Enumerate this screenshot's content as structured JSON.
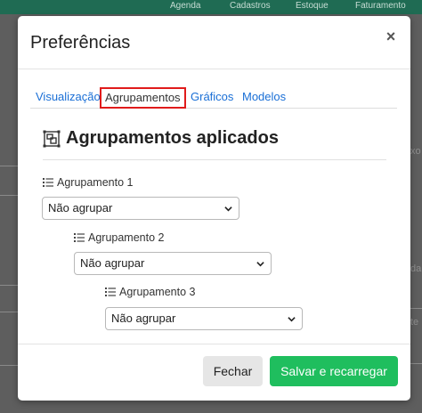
{
  "background": {
    "nav": [
      "Agenda",
      "Cadastros",
      "Estoque",
      "Faturamento"
    ],
    "fragments": [
      "xo",
      "da",
      "te"
    ]
  },
  "modal": {
    "title": "Preferências",
    "close_symbol": "×"
  },
  "tabs": [
    {
      "label": "Visualização",
      "active": false
    },
    {
      "label": "Agrupamentos",
      "active": true
    },
    {
      "label": "Gráficos",
      "active": false
    },
    {
      "label": "Modelos",
      "active": false
    }
  ],
  "section": {
    "title": "Agrupamentos aplicados",
    "icon": "object-group-icon"
  },
  "groups": [
    {
      "label": "Agrupamento 1",
      "value": "Não agrupar"
    },
    {
      "label": "Agrupamento 2",
      "value": "Não agrupar"
    },
    {
      "label": "Agrupamento 3",
      "value": "Não agrupar"
    }
  ],
  "footer": {
    "close_label": "Fechar",
    "save_label": "Salvar e recarregar"
  },
  "colors": {
    "tab_link": "#1a6fd6",
    "active_tab_outline": "#e01b1b",
    "save_button": "#1fbe5e",
    "topbar": "#1f6b53"
  }
}
